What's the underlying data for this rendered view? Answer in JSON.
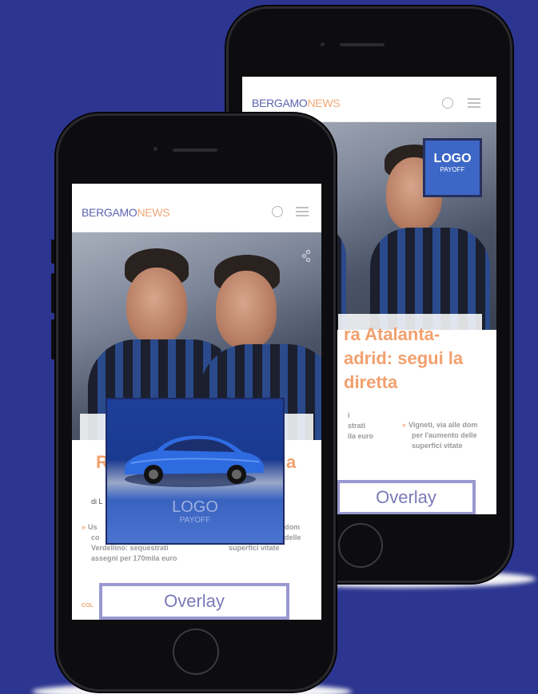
{
  "back_phone": {
    "brand_part1": "BERGAMO",
    "brand_part2": "NEWS",
    "logo_badge": {
      "title": "LOGO",
      "subtitle": "PAYOFF"
    },
    "headline_lines": [
      "ra Atalanta-",
      "adrid: segui la",
      "diretta"
    ],
    "left_snippet_lines": [
      "i",
      "strati",
      "ila euro"
    ],
    "right_snippet": {
      "marker": "»",
      "lines": [
        "Vigneti, via alle dom",
        "per l'aumento delle",
        "superfici vitate"
      ]
    },
    "overlay_label": "Overlay"
  },
  "front_phone": {
    "brand_part1": "BERGAMO",
    "brand_part2": "NEWS",
    "headline_left": "R",
    "headline_right": "a",
    "byline_fragment": "di L",
    "left_snippet": {
      "marker": "»",
      "lines": [
        "Us",
        "co",
        "Verdellino: sequestrati",
        "assegni per 170mila euro"
      ]
    },
    "right_snippet_lines": [
      "dom",
      "delle",
      "superfici vitate"
    ],
    "category_fragment": "COL",
    "ad": {
      "logo": "LOGO",
      "payoff": "PAYOFF"
    },
    "overlay_label": "Overlay"
  },
  "colors": {
    "background": "#2c3590",
    "brand_primary": "#5c63b0",
    "brand_accent": "#f0a878",
    "logo_blue": "#3c67c6",
    "overlay_border": "#9a98d0"
  }
}
